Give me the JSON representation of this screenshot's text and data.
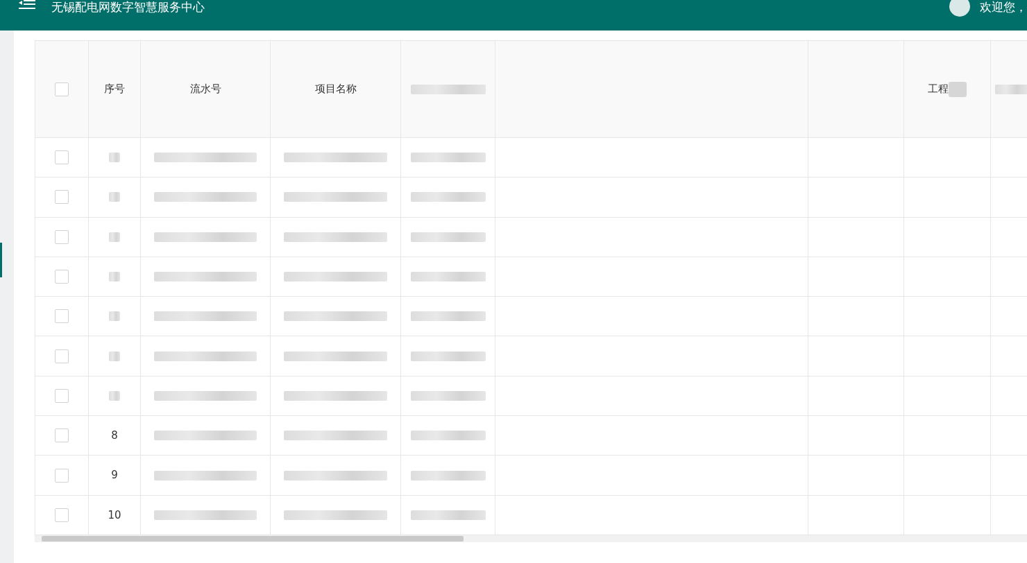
{
  "header": {
    "title": "无锡配电网数字智慧服务中心",
    "greeting": "欢迎您，"
  },
  "table": {
    "columns": [
      {
        "kind": "checkbox",
        "checked": false
      },
      {
        "kind": "text",
        "label": "序号"
      },
      {
        "kind": "text",
        "label": "流水号",
        "blurred_cells": true
      },
      {
        "kind": "text",
        "label": "项目名称",
        "blurred_cells": true
      },
      {
        "kind": "blurred",
        "blurred_cells": true
      },
      {
        "kind": "blank"
      },
      {
        "kind": "blank"
      },
      {
        "kind": "text",
        "label": "工程",
        "blurred_label": true
      },
      {
        "kind": "blurred"
      }
    ],
    "rows": [
      {
        "checked": false
      },
      {
        "checked": false
      },
      {
        "checked": false
      },
      {
        "checked": false
      },
      {
        "checked": false
      },
      {
        "checked": false
      },
      {
        "checked": false
      },
      {
        "checked": false,
        "index": "8"
      },
      {
        "checked": false,
        "index": "9"
      },
      {
        "checked": false,
        "index": "10"
      }
    ]
  }
}
